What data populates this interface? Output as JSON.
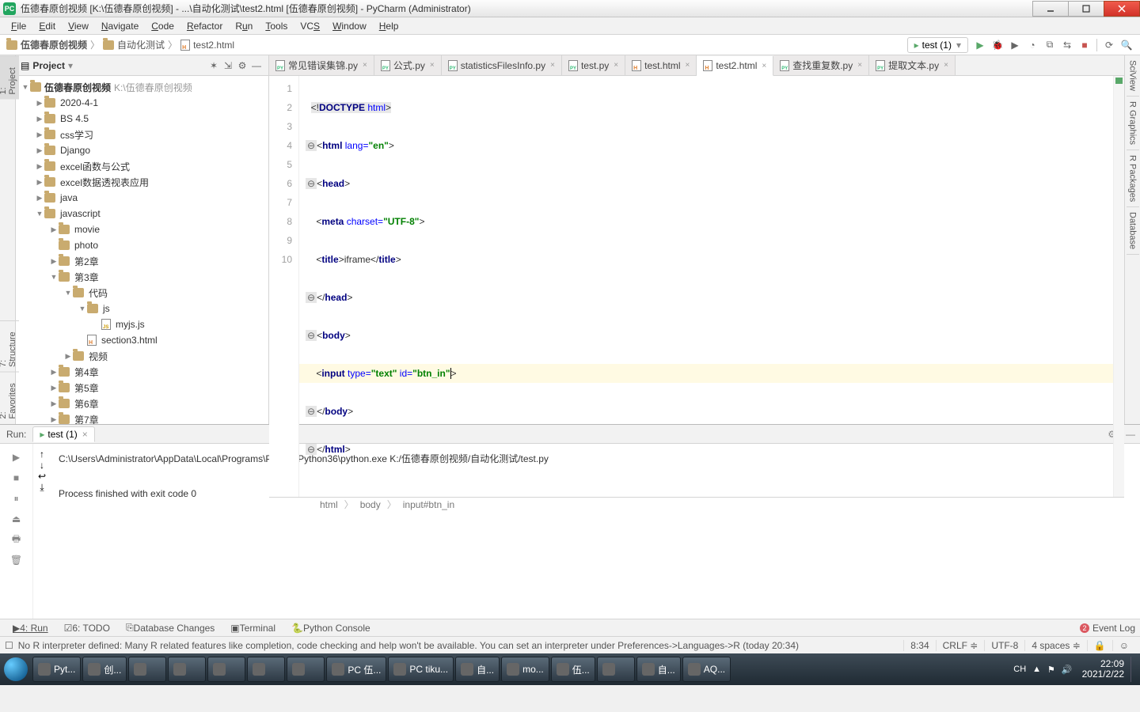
{
  "window": {
    "title": "伍德春原创视频 [K:\\伍德春原创视频] - ...\\自动化测试\\test2.html [伍德春原创视频] - PyCharm (Administrator)"
  },
  "menu": [
    "File",
    "Edit",
    "View",
    "Navigate",
    "Code",
    "Refactor",
    "Run",
    "Tools",
    "VCS",
    "Window",
    "Help"
  ],
  "breadcrumbs": {
    "root": "伍德春原创视频",
    "mid": "自动化测试",
    "file": "test2.html"
  },
  "run_config": "test (1)",
  "project": {
    "title": "Project",
    "root": {
      "name": "伍德春原创视频",
      "path": "K:\\伍德春原创视频"
    },
    "nodes": [
      {
        "d": 1,
        "a": "▶",
        "name": "2020-4-1",
        "t": "folder"
      },
      {
        "d": 1,
        "a": "▶",
        "name": "BS 4.5",
        "t": "folder"
      },
      {
        "d": 1,
        "a": "▶",
        "name": "css学习",
        "t": "folder"
      },
      {
        "d": 1,
        "a": "▶",
        "name": "Django",
        "t": "folder"
      },
      {
        "d": 1,
        "a": "▶",
        "name": "excel函数与公式",
        "t": "folder"
      },
      {
        "d": 1,
        "a": "▶",
        "name": "excel数据透视表应用",
        "t": "folder"
      },
      {
        "d": 1,
        "a": "▶",
        "name": "java",
        "t": "folder"
      },
      {
        "d": 1,
        "a": "▼",
        "name": "javascript",
        "t": "folder"
      },
      {
        "d": 2,
        "a": "▶",
        "name": "movie",
        "t": "folder"
      },
      {
        "d": 2,
        "a": "",
        "name": "photo",
        "t": "folder"
      },
      {
        "d": 2,
        "a": "▶",
        "name": "第2章",
        "t": "folder"
      },
      {
        "d": 2,
        "a": "▼",
        "name": "第3章",
        "t": "folder"
      },
      {
        "d": 3,
        "a": "▼",
        "name": "代码",
        "t": "folder"
      },
      {
        "d": 4,
        "a": "▼",
        "name": "js",
        "t": "folder"
      },
      {
        "d": 5,
        "a": "",
        "name": "myjs.js",
        "t": "js"
      },
      {
        "d": 4,
        "a": "",
        "name": "section3.html",
        "t": "html"
      },
      {
        "d": 3,
        "a": "▶",
        "name": "视频",
        "t": "folder"
      },
      {
        "d": 2,
        "a": "▶",
        "name": "第4章",
        "t": "folder"
      },
      {
        "d": 2,
        "a": "▶",
        "name": "第5章",
        "t": "folder"
      },
      {
        "d": 2,
        "a": "▶",
        "name": "第6章",
        "t": "folder"
      },
      {
        "d": 2,
        "a": "▶",
        "name": "第7章",
        "t": "folder"
      }
    ]
  },
  "tabs": [
    {
      "label": "常见错误集锦.py",
      "t": "py"
    },
    {
      "label": "公式.py",
      "t": "py"
    },
    {
      "label": "statisticsFilesInfo.py",
      "t": "py"
    },
    {
      "label": "test.py",
      "t": "py"
    },
    {
      "label": "test.html",
      "t": "html"
    },
    {
      "label": "test2.html",
      "t": "html",
      "active": true
    },
    {
      "label": "查找重复数.py",
      "t": "py"
    },
    {
      "label": "提取文本.py",
      "t": "py"
    }
  ],
  "code_breadcrumb": [
    "html",
    "body",
    "input#btn_in"
  ],
  "editor_lines": 10,
  "run": {
    "label": "Run:",
    "tab": "test (1)",
    "output1": "C:\\Users\\Administrator\\AppData\\Local\\Programs\\Python\\Python36\\python.exe K:/伍德春原创视频/自动化测试/test.py",
    "output2": "Process finished with exit code 0"
  },
  "bottom_tabs": {
    "run": "4: Run",
    "todo": "6: TODO",
    "db": "Database Changes",
    "term": "Terminal",
    "pycon": "Python Console",
    "event": "Event Log"
  },
  "status": {
    "msg": "No R interpreter defined: Many R related features like completion, code checking and help won't be available. You can set an interpreter under Preferences->Languages->R (today 20:34)",
    "pos": "8:34",
    "eol": "CRLF",
    "enc": "UTF-8",
    "indent": "4 spaces"
  },
  "side_left": {
    "project": "1: Project",
    "structure": "7: Structure",
    "favorites": "2: Favorites"
  },
  "side_right": {
    "sci": "SciView",
    "rg": "R Graphics",
    "rp": "R Packages",
    "db": "Database"
  },
  "taskbar": {
    "items": [
      "Pyt...",
      "创...",
      "",
      "",
      "",
      "",
      "",
      "PC 伍...",
      "PC tiku...",
      "自...",
      "mo...",
      "伍...",
      "",
      "自...",
      "AQ..."
    ],
    "tray": [
      "CH",
      "▲"
    ],
    "clock_time": "22:09",
    "clock_date": "2021/2/22"
  }
}
